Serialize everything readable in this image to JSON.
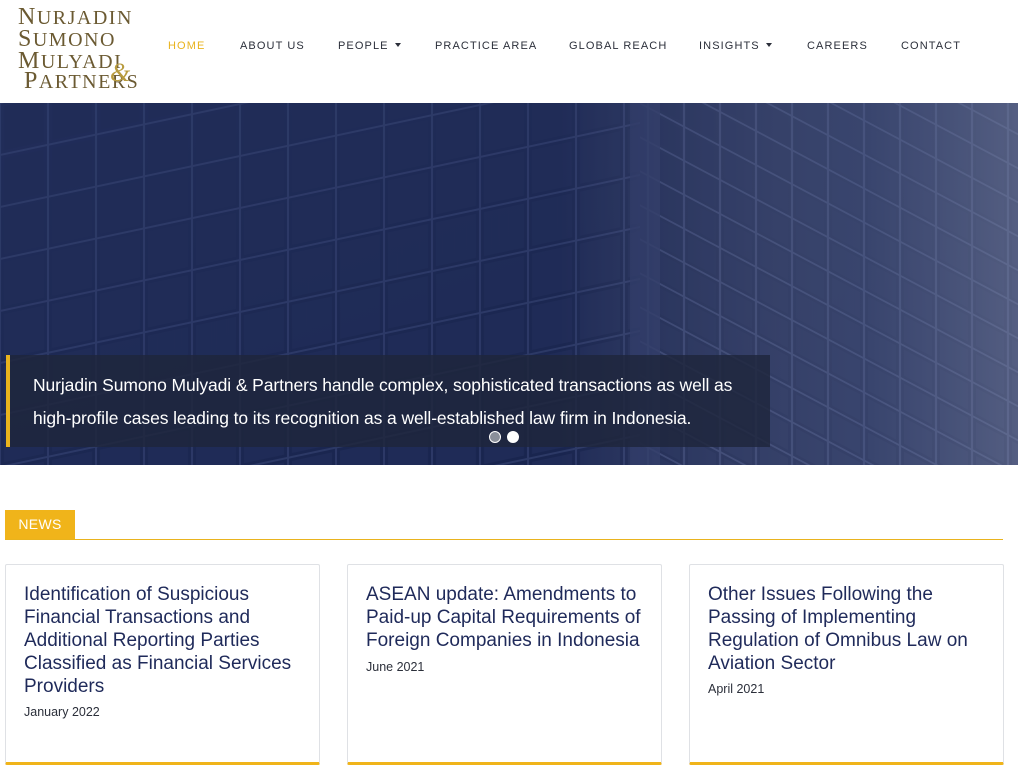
{
  "logo": {
    "line1": "Nurjadin",
    "line2": "Sumono",
    "line3": "Mulyadi",
    "line4": "Partners",
    "ampersand": "&"
  },
  "nav": {
    "items": [
      {
        "label": "HOME",
        "active": true
      },
      {
        "label": "ABOUT US"
      },
      {
        "label": "PEOPLE",
        "dropdown": true
      },
      {
        "label": "PRACTICE AREA"
      },
      {
        "label": "GLOBAL REACH"
      },
      {
        "label": "INSIGHTS",
        "dropdown": true
      },
      {
        "label": "CAREERS"
      },
      {
        "label": "CONTACT"
      }
    ]
  },
  "hero": {
    "caption": "Nurjadin Sumono Mulyadi & Partners handle complex, sophisticated transactions as well as high-profile cases leading to its recognition as a well-established law firm in Indonesia.",
    "slide_count": 2,
    "active_slide": 2
  },
  "news": {
    "label": "NEWS",
    "cards": [
      {
        "title": "Identification of Suspicious Financial Transactions and Additional Reporting Parties Classified as Financial Services Providers",
        "date": "January 2022"
      },
      {
        "title": "ASEAN update: Amendments to Paid-up Capital Requirements of Foreign Companies in Indonesia",
        "date": "June 2021"
      },
      {
        "title": "Other Issues Following the Passing of Implementing Regulation of Omnibus Law on Aviation Sector",
        "date": "April 2021"
      }
    ]
  },
  "colors": {
    "accent": "#f0b41a",
    "navy": "#1f2a5a",
    "hero_overlay": "#1e2a52"
  }
}
